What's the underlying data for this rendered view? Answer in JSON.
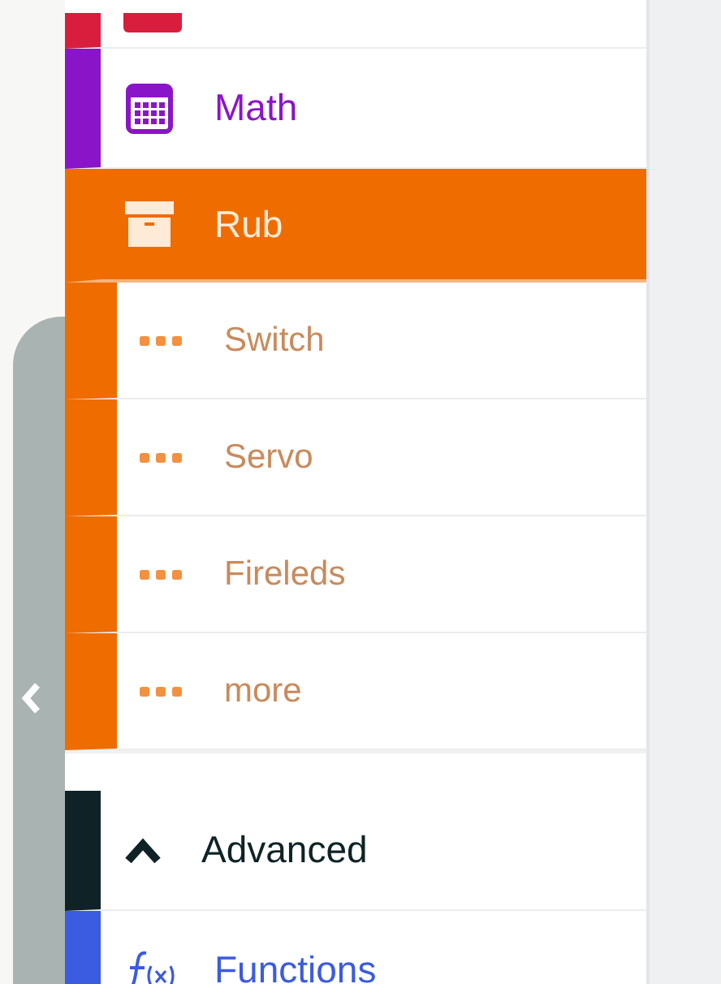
{
  "toolbox": {
    "categories": [
      {
        "kind": "category",
        "color": "#d81e3c",
        "selected": false
      },
      {
        "kind": "category",
        "name": "Math",
        "color": "#8a15c8",
        "selected": false
      },
      {
        "kind": "category",
        "name": "Rub",
        "color": "#ef6c00",
        "selected": true,
        "children": [
          {
            "name": "Switch"
          },
          {
            "name": "Servo"
          },
          {
            "name": "Fireleds"
          },
          {
            "name": "more"
          }
        ]
      },
      {
        "kind": "advanced",
        "name": "Advanced",
        "color": "#0f2326",
        "expanded": true
      },
      {
        "kind": "category",
        "name": "Functions",
        "color": "#3b5be0",
        "selected": false
      }
    ]
  }
}
